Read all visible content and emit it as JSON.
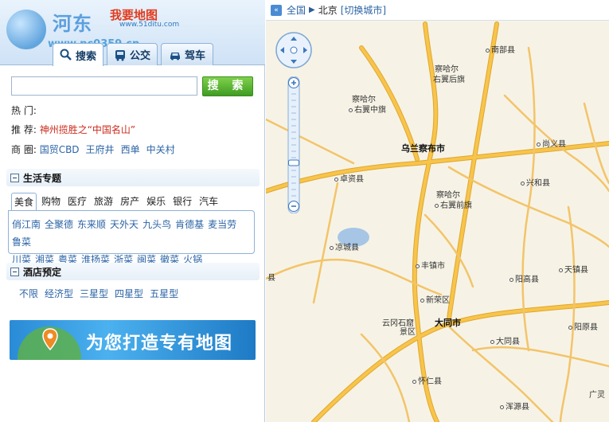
{
  "header": {
    "logo_text": "河东",
    "logo_51": "我要地图",
    "logo_site": "www.pc0359.cn",
    "logo_url2": "www.51ditu.com"
  },
  "tabs": [
    {
      "label": "搜索",
      "icon": "search-icon",
      "active": true
    },
    {
      "label": "公交",
      "icon": "bus-icon",
      "active": false
    },
    {
      "label": "驾车",
      "icon": "car-icon",
      "active": false
    }
  ],
  "search": {
    "placeholder": "",
    "value": "",
    "button_label": "搜 索"
  },
  "hot": {
    "label": "热  门:"
  },
  "recommend": {
    "label": "推  荐:",
    "text": "神州揽胜之“中国名山”"
  },
  "business": {
    "label": "商  圈:",
    "items": [
      "国贸CBD",
      "王府井",
      "西单",
      "中关村"
    ]
  },
  "life_section": {
    "title": "生活专题"
  },
  "categories": [
    "美食",
    "购物",
    "医疗",
    "旅游",
    "房产",
    "娱乐",
    "银行",
    "汽车"
  ],
  "food_items": [
    "俏江南",
    "全聚德",
    "东来顺",
    "天外天",
    "九头鸟",
    "肯德基",
    "麦当劳",
    "鲁菜",
    "川菜",
    "湘菜",
    "粤菜",
    "淮扬菜",
    "浙菜",
    "闽菜",
    "徽菜",
    "火锅"
  ],
  "hotel_section": {
    "title": "酒店预定"
  },
  "hotel_items": [
    "不限",
    "经济型",
    "三星型",
    "四星型",
    "五星型"
  ],
  "banner": {
    "text": "为您打造专有地图"
  },
  "map": {
    "breadcrumb": {
      "root": "全国",
      "city": "北京",
      "switch": "[切换城市]"
    },
    "places": [
      {
        "name": "南部县",
        "big": false
      },
      {
        "name": "察哈尔",
        "big": false
      },
      {
        "name": "右翼后旗",
        "big": false
      },
      {
        "name": "察哈尔",
        "big": false
      },
      {
        "name": "右翼中旗",
        "big": false
      },
      {
        "name": "乌兰察布市",
        "big": true
      },
      {
        "name": "尚义县",
        "big": false
      },
      {
        "name": "卓资县",
        "big": false
      },
      {
        "name": "兴和县",
        "big": false
      },
      {
        "name": "察哈尔",
        "big": false
      },
      {
        "name": "右翼前旗",
        "big": false
      },
      {
        "name": "凉城县",
        "big": false
      },
      {
        "name": "丰镇市",
        "big": false
      },
      {
        "name": "天镇县",
        "big": false
      },
      {
        "name": "阳高县",
        "big": false
      },
      {
        "name": "新荣区",
        "big": false
      },
      {
        "name": "云冈石窟",
        "big": false
      },
      {
        "name": "景区",
        "big": false
      },
      {
        "name": "大同市",
        "big": true
      },
      {
        "name": "阳原县",
        "big": false
      },
      {
        "name": "大同县",
        "big": false
      },
      {
        "name": "怀仁县",
        "big": false
      },
      {
        "name": "浑源县",
        "big": false
      },
      {
        "name": "广灵",
        "big": false
      },
      {
        "name": "县",
        "big": false
      }
    ]
  },
  "colors": {
    "road": "#f7c44c",
    "road_edge": "#e4a92a",
    "accent": "#2b64a6",
    "button": "#4aa82a"
  }
}
